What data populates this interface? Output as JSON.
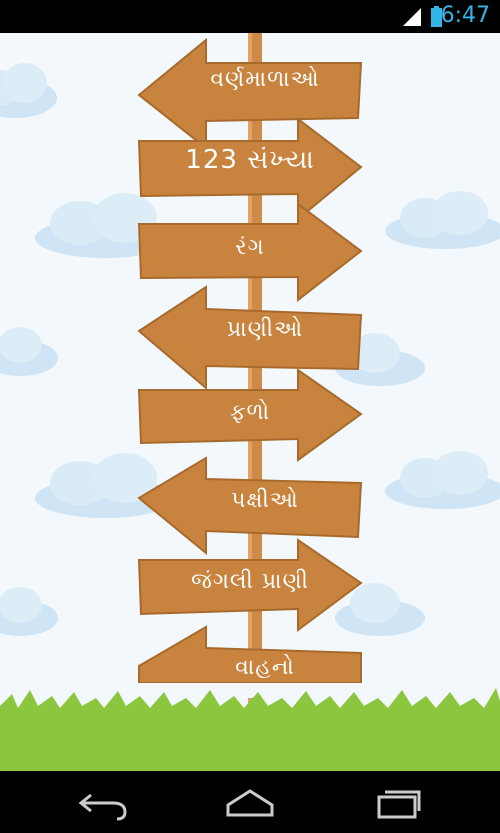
{
  "status_bar": {
    "time": "6:47",
    "icons": [
      "signal-icon",
      "battery-icon"
    ]
  },
  "signs": [
    {
      "label": "વર્ણમાળાઓ",
      "direction": "left"
    },
    {
      "label": "123 સંખ્યા",
      "direction": "right"
    },
    {
      "label": "રંગ",
      "direction": "right"
    },
    {
      "label": "પ્રાણીઓ",
      "direction": "left"
    },
    {
      "label": "ફળો",
      "direction": "right"
    },
    {
      "label": "પક્ષીઓ",
      "direction": "left"
    },
    {
      "label": "જંગલી પ્રાણી",
      "direction": "right"
    },
    {
      "label": "વાહનો",
      "direction": "left"
    }
  ],
  "nav_bar": {
    "buttons": [
      "back-icon",
      "home-icon",
      "recent-apps-icon"
    ]
  },
  "colors": {
    "sign": "#c8843f",
    "sign_edge": "#a86a2c",
    "pole": "#cf8a45",
    "sky": "#f2f8fc",
    "grass": "#8cc63f",
    "status_accent": "#33b5e5"
  }
}
